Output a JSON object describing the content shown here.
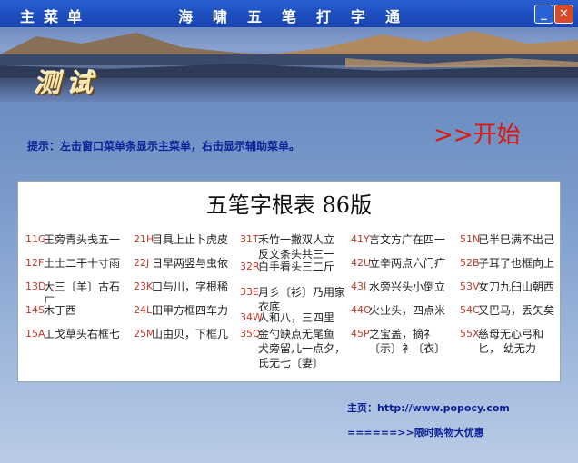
{
  "window": {
    "menu_title": "主菜单",
    "app_title": "海啸五笔打字通",
    "min_label": "_",
    "close_label": "✕"
  },
  "banner": {
    "section_title": "测试"
  },
  "hint": "提示：左击窗口菜单条显示主菜单，右击显示辅助菜单。",
  "start": ">>开始",
  "table": {
    "title": "五笔字根表  86版",
    "columns": [
      [
        {
          "code": "11G",
          "text": "王旁青头戋五一"
        },
        {
          "code": "12F",
          "text": "土士二干十寸雨"
        },
        {
          "code": "13D",
          "text": "大三〔羊〕古石厂"
        },
        {
          "code": "14S",
          "text": "木丁西"
        },
        {
          "code": "15A",
          "text": "工戈草头右框七"
        }
      ],
      [
        {
          "code": "21H",
          "text": "目具上止卜虎皮"
        },
        {
          "code": "22J",
          "text": "日早两竖与虫依"
        },
        {
          "code": "23K",
          "text": "口与川，字根稀"
        },
        {
          "code": "24L",
          "text": "田甲方框四车力"
        },
        {
          "code": "25M",
          "text": "山由贝，下框几"
        }
      ],
      [
        {
          "code": "31T",
          "text": "禾竹一撇双人立 反文条头共三一"
        },
        {
          "code": "32R",
          "text": "白手看头三二斤"
        },
        {
          "code": "33E",
          "text": "月彡〔衫〕乃用家 衣底"
        },
        {
          "code": "34W",
          "text": "人和八，三四里"
        },
        {
          "code": "35Q",
          "text": "金勺缺点无尾鱼 犬旁留儿一点夕， 氏无七〔妻〕"
        }
      ],
      [
        {
          "code": "41Y",
          "text": "言文方广在四一"
        },
        {
          "code": "42U",
          "text": "立辛两点六门疒"
        },
        {
          "code": "43I",
          "text": "水旁兴头小倒立"
        },
        {
          "code": "44O",
          "text": "火业头，四点米"
        },
        {
          "code": "45P",
          "text": "之宝盖，摘礻 〔示〕衤〔衣〕"
        }
      ],
      [
        {
          "code": "51N",
          "text": "已半巳满不出己"
        },
        {
          "code": "52B",
          "text": "子耳了也框向上"
        },
        {
          "code": "53V",
          "text": "女刀九臼山朝西"
        },
        {
          "code": "54C",
          "text": "又巴马，丢矢矣"
        },
        {
          "code": "55X",
          "text": "慈母无心弓和匕， 幼无力"
        }
      ]
    ]
  },
  "footer": {
    "home": "主页：http://www.popocy.com",
    "promo": "======>>限时购物大优惠"
  }
}
